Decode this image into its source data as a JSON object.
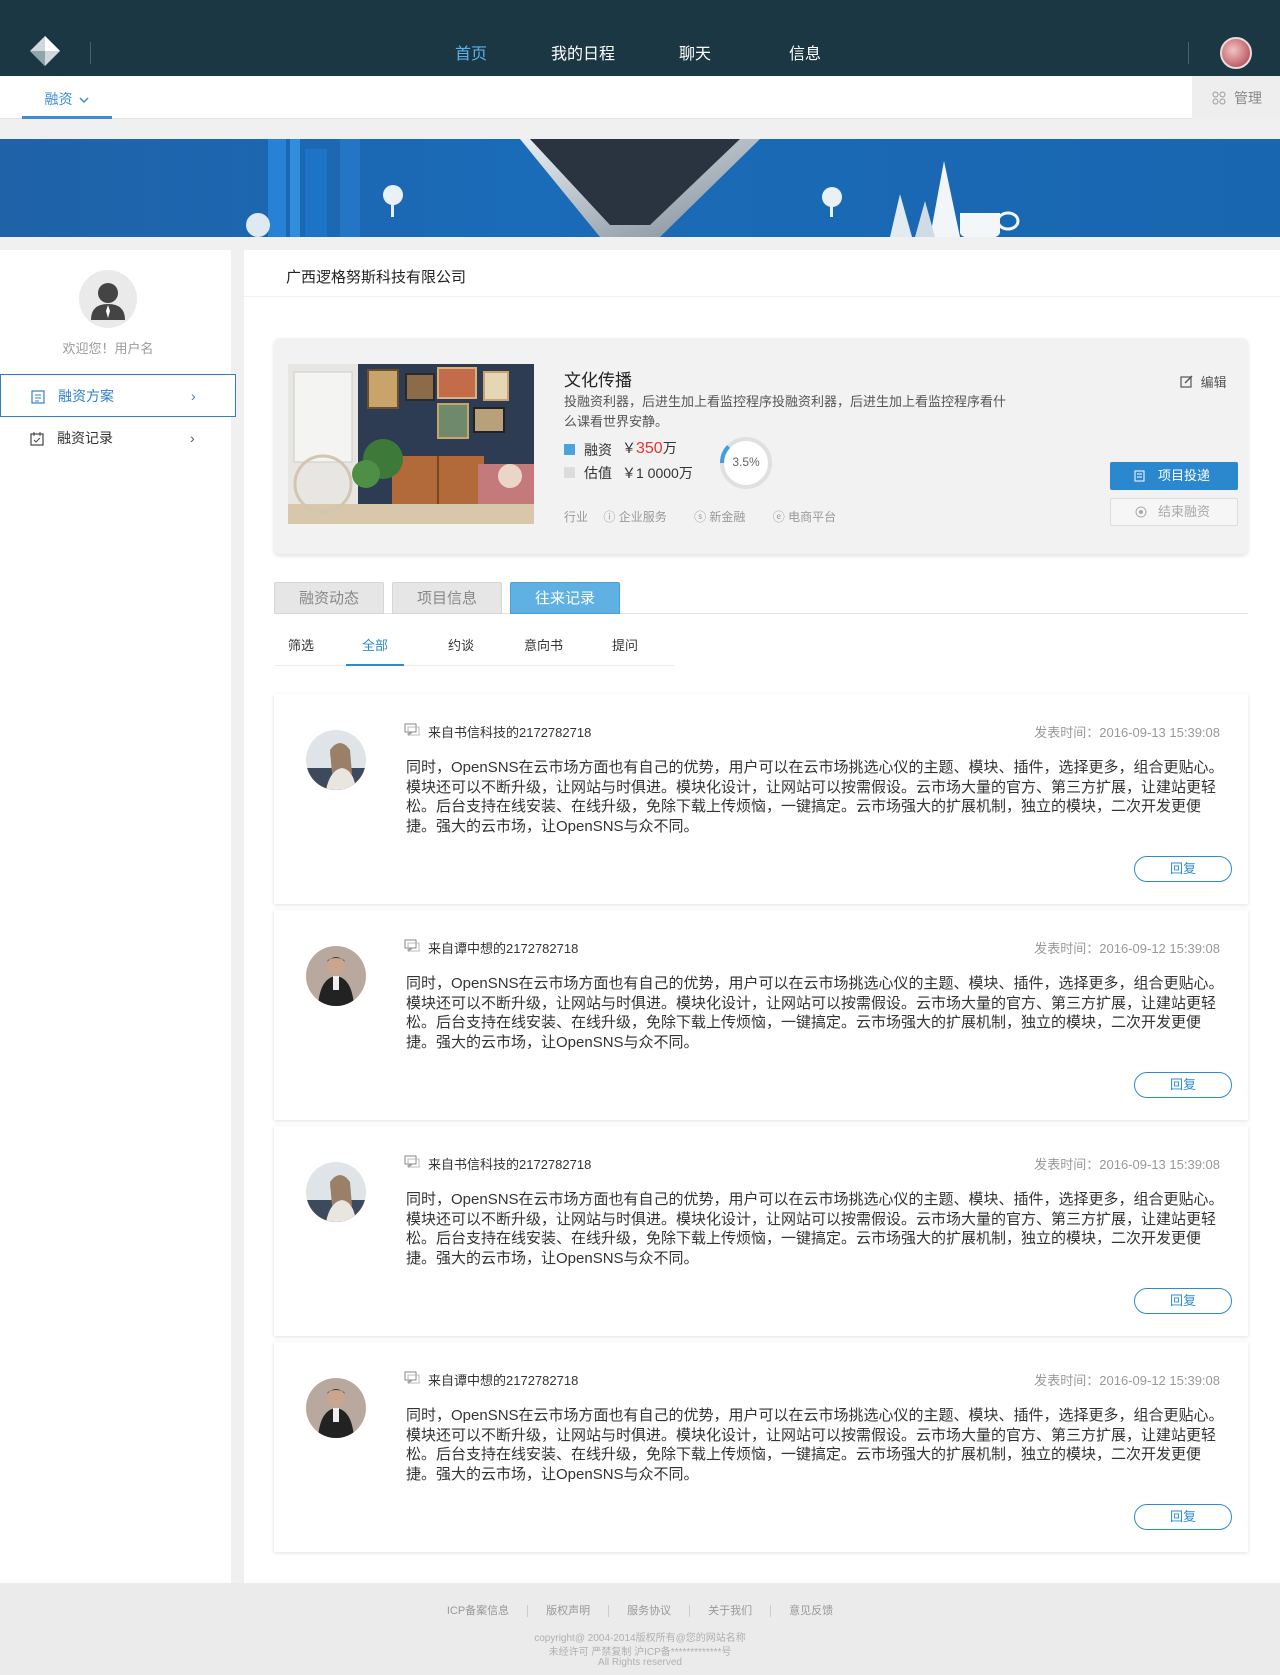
{
  "nav": {
    "items": [
      "首页",
      "我的日程",
      "聊天",
      "信息"
    ],
    "active_index": 0
  },
  "subnav": {
    "tab_label": "融资",
    "manage_label": "管理"
  },
  "sidebar": {
    "welcome": "欢迎您！用户名",
    "items": [
      {
        "label": "融资方案",
        "icon": "clipboard-icon",
        "active": true
      },
      {
        "label": "融资记录",
        "icon": "calendar-icon",
        "active": false
      }
    ]
  },
  "company": "广西逻格努斯科技有限公司",
  "project": {
    "title": "文化传播",
    "description": "投融资利器，后进生加上看监控程序投融资利器，后进生加上看监控程序看什么课看世界安静。",
    "financing_label": "融资",
    "financing_prefix": "￥",
    "financing_amount": "350",
    "financing_unit": "万",
    "valuation_label": "估值",
    "valuation_value": "￥1 0000万",
    "progress_text": "3.5%",
    "progress_value": 0.035,
    "industry_label": "行业",
    "tags": [
      "企业服务",
      "新金融",
      "电商平台"
    ],
    "edit_label": "编辑",
    "invest_button": "项目投递",
    "end_button": "结束融资"
  },
  "tabs": [
    "融资动态",
    "项目信息",
    "往来记录"
  ],
  "tab_active_index": 2,
  "filters": [
    "筛选",
    "全部",
    "约谈",
    "意向书",
    "提问"
  ],
  "filter_active_index": 1,
  "posts": [
    {
      "from": "来自书信科技的2172782718",
      "time": "发表时间：2016-09-13    15:39:08",
      "body": "同时，OpenSNS在云市场方面也有自己的优势，用户可以在云市场挑选心仪的主题、模块、插件，选择更多，组合更贴心。模块还可以不断升级，让网站与时俱进。模块化设计，让网站可以按需假设。云市场大量的官方、第三方扩展，让建站更轻松。后台支持在线安装、在线升级，免除下载上传烦恼，一键搞定。云市场强大的扩展机制，独立的模块，二次开发更便捷。强大的云市场，让OpenSNS与众不同。",
      "reply": "回复"
    },
    {
      "from": "来自谭中想的2172782718",
      "time": "发表时间：2016-09-12  15:39:08",
      "body": "同时，OpenSNS在云市场方面也有自己的优势，用户可以在云市场挑选心仪的主题、模块、插件，选择更多，组合更贴心。模块还可以不断升级，让网站与时俱进。模块化设计，让网站可以按需假设。云市场大量的官方、第三方扩展，让建站更轻松。后台支持在线安装、在线升级，免除下载上传烦恼，一键搞定。云市场强大的扩展机制，独立的模块，二次开发更便捷。强大的云市场，让OpenSNS与众不同。",
      "reply": "回复"
    },
    {
      "from": "来自书信科技的2172782718",
      "time": "发表时间：2016-09-13    15:39:08",
      "body": "同时，OpenSNS在云市场方面也有自己的优势，用户可以在云市场挑选心仪的主题、模块、插件，选择更多，组合更贴心。模块还可以不断升级，让网站与时俱进。模块化设计，让网站可以按需假设。云市场大量的官方、第三方扩展，让建站更轻松。后台支持在线安装、在线升级，免除下载上传烦恼，一键搞定。云市场强大的扩展机制，独立的模块，二次开发更便捷。强大的云市场，让OpenSNS与众不同。",
      "reply": "回复"
    },
    {
      "from": "来自谭中想的2172782718",
      "time": "发表时间：2016-09-12  15:39:08",
      "body": "同时，OpenSNS在云市场方面也有自己的优势，用户可以在云市场挑选心仪的主题、模块、插件，选择更多，组合更贴心。模块还可以不断升级，让网站与时俱进。模块化设计，让网站可以按需假设。云市场大量的官方、第三方扩展，让建站更轻松。后台支持在线安装、在线升级，免除下载上传烦恼，一键搞定。云市场强大的扩展机制，独立的模块，二次开发更便捷。强大的云市场，让OpenSNS与众不同。",
      "reply": "回复"
    }
  ],
  "footer": {
    "links": [
      "ICP备案信息",
      "版权声明",
      "服务协议",
      "关于我们",
      "意见反馈"
    ],
    "copyright": "copyright@ 2004-2014版权所有@您的网站名称",
    "notice": "未经许可 严禁复制 沪ICP备*************号",
    "rights": "All Rights reserved"
  },
  "colors": {
    "topbar": "#1c3744",
    "accent": "#2f8ad3",
    "tab_active": "#5eb1e2",
    "price_red": "#e8332f"
  }
}
